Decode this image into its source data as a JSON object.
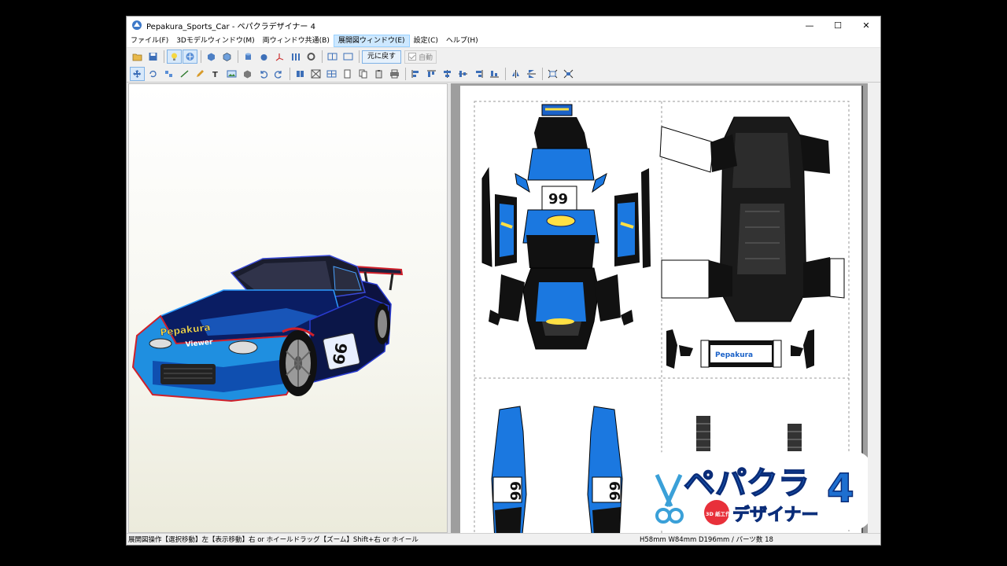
{
  "window": {
    "title": "Pepakura_Sports_Car - ペパクラデザイナー 4",
    "controls": {
      "minimize": "—",
      "maximize": "☐",
      "close": "✕"
    }
  },
  "menu": [
    {
      "label": "ファイル(F)"
    },
    {
      "label": "3Dモデルウィンドウ(M)"
    },
    {
      "label": "両ウィンドウ共通(B)"
    },
    {
      "label": "展開図ウィンドウ(E)"
    },
    {
      "label": "設定(C)"
    },
    {
      "label": "ヘルプ(H)"
    }
  ],
  "toolbar": {
    "restore_label": "元に戻す",
    "auto_label": "自動",
    "auto_checked": true
  },
  "model": {
    "number": "66",
    "brand_top": "Pepakura",
    "brand_bottom": "Viewer"
  },
  "layout": {
    "hood_number": "99",
    "door_number_left": "66",
    "door_number_right": "66",
    "sticker_text": "Pepakura"
  },
  "logo": {
    "line1": "ペパクラ",
    "line2": "デザイナー",
    "version": "4",
    "badge": "3D 紙工作用 ソフト"
  },
  "status": {
    "left": "展開図操作【選択移動】左【表示移動】右 or ホイールドラッグ【ズーム】Shift+右 or ホイール",
    "right": "H58mm W84mm D196mm / パーツ数 18"
  }
}
